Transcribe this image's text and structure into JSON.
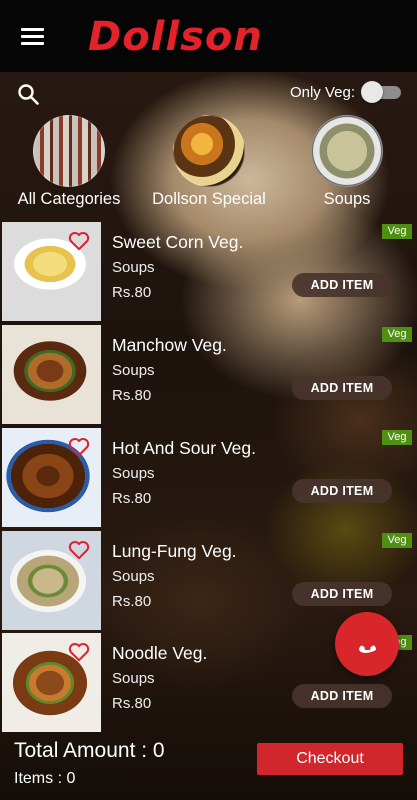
{
  "header": {
    "brand": "Dollson"
  },
  "filter": {
    "veg_label": "Only Veg:",
    "veg_on": false
  },
  "categories": [
    {
      "label": "All Categories"
    },
    {
      "label": "Dollson Special"
    },
    {
      "label": "Soups"
    }
  ],
  "items": [
    {
      "name": "Sweet Corn Veg.",
      "category": "Soups",
      "price": "Rs.80",
      "badge": "Veg",
      "action": "ADD ITEM"
    },
    {
      "name": "Manchow Veg.",
      "category": "Soups",
      "price": "Rs.80",
      "badge": "Veg",
      "action": "ADD ITEM"
    },
    {
      "name": "Hot And Sour Veg.",
      "category": "Soups",
      "price": "Rs.80",
      "badge": "Veg",
      "action": "ADD ITEM"
    },
    {
      "name": "Lung-Fung Veg.",
      "category": "Soups",
      "price": "Rs.80",
      "badge": "Veg",
      "action": "ADD ITEM"
    },
    {
      "name": "Noodle Veg.",
      "category": "Soups",
      "price": "Rs.80",
      "badge": "Veg",
      "action": "ADD ITEM"
    }
  ],
  "footer": {
    "total_label": "Total Amount : 0",
    "items_label": "Items : 0",
    "checkout_label": "Checkout"
  },
  "colors": {
    "brand": "#e32229",
    "veg": "#4f8f12",
    "checkout": "#d0262c"
  }
}
